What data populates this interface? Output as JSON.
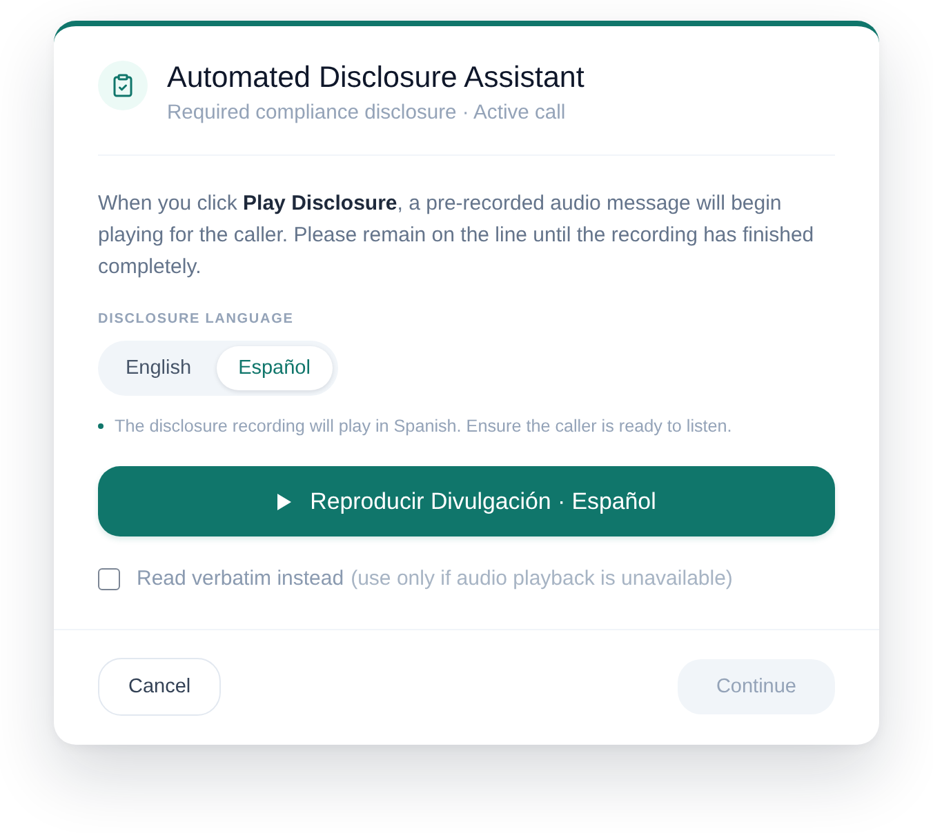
{
  "header": {
    "title": "Automated Disclosure Assistant",
    "subtitle": "Required compliance disclosure · Active call"
  },
  "intro": "When you click **Play Disclosure**, a pre-recorded audio message will begin playing for the caller. Please remain on the line until the recording has finished completely.",
  "language": {
    "label": "DISCLOSURE LANGUAGE",
    "options": [
      {
        "label": "English",
        "selected": false
      },
      {
        "label": "Español",
        "selected": true
      }
    ],
    "note": "The disclosure recording will play in Spanish. Ensure the caller is ready to listen."
  },
  "play_button": {
    "label": "Reproducir Divulgación · Español"
  },
  "verbatim": {
    "checked": false,
    "label": "Read verbatim instead",
    "hint": "(use only if audio playback is unavailable)"
  },
  "footer": {
    "buttons": [
      {
        "label": "Cancel",
        "kind": "secondary",
        "disabled": false
      },
      {
        "label": "Continue",
        "kind": "primary",
        "disabled": true
      }
    ]
  }
}
